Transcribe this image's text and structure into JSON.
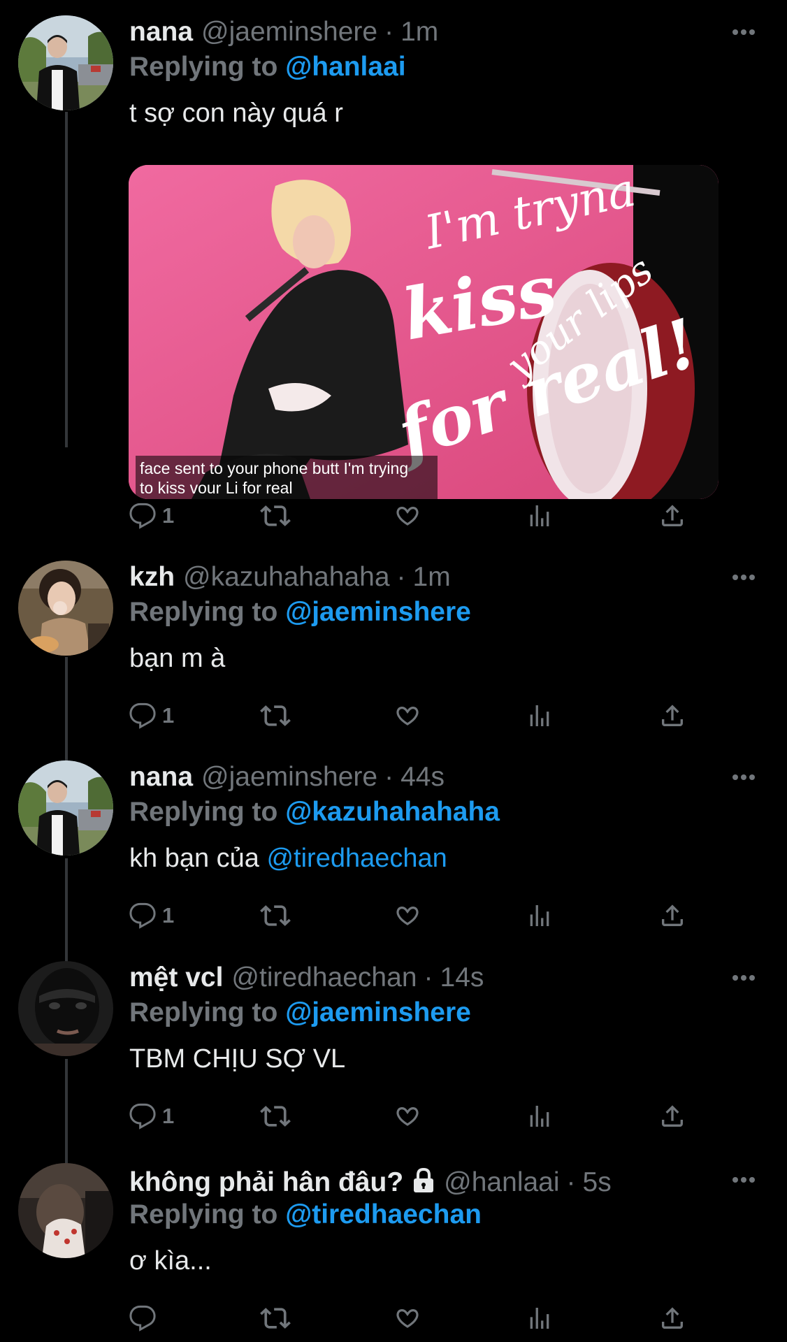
{
  "tweets": [
    {
      "name": "nana",
      "handle": "@jaeminshere",
      "time": "1m",
      "replying_label": "Replying to",
      "replying_to": "@hanlaai",
      "text": "t sợ con này quá r",
      "media": {
        "overlay_lines": [
          "I'm tryna",
          "kiss",
          "your lips",
          "for real!"
        ],
        "caption_line1": "face sent to your phone butt I'm trying",
        "caption_line2": "to kiss vour Li for real"
      },
      "reply_count": "1"
    },
    {
      "name": "kzh",
      "handle": "@kazuhahahaha",
      "time": "1m",
      "replying_label": "Replying to",
      "replying_to": "@jaeminshere",
      "text": "bạn m à",
      "reply_count": "1"
    },
    {
      "name": "nana",
      "handle": "@jaeminshere",
      "time": "44s",
      "replying_label": "Replying to",
      "replying_to": "@kazuhahahaha",
      "text": "kh bạn của ",
      "text_mention": "@tiredhaechan",
      "reply_count": "1"
    },
    {
      "name": "mệt vcl",
      "handle": "@tiredhaechan",
      "time": "14s",
      "replying_label": "Replying to",
      "replying_to": "@jaeminshere",
      "text": "TBM CHỊU SỢ VL",
      "reply_count": "1"
    },
    {
      "name": "không phải hân đâu?",
      "handle": "@hanlaai",
      "time": "5s",
      "replying_label": "Replying to",
      "replying_to": "@tiredhaechan",
      "text": "ơ kìa...",
      "reply_count": ""
    }
  ],
  "separator": "·",
  "colors": {
    "background": "#000000",
    "text": "#e7e9ea",
    "secondary": "#71767b",
    "accent": "#1d9bf0",
    "thread_line": "#333639"
  },
  "icons": [
    "more-icon",
    "reply-icon",
    "retweet-icon",
    "like-icon",
    "analytics-icon",
    "share-icon",
    "lock-icon"
  ]
}
